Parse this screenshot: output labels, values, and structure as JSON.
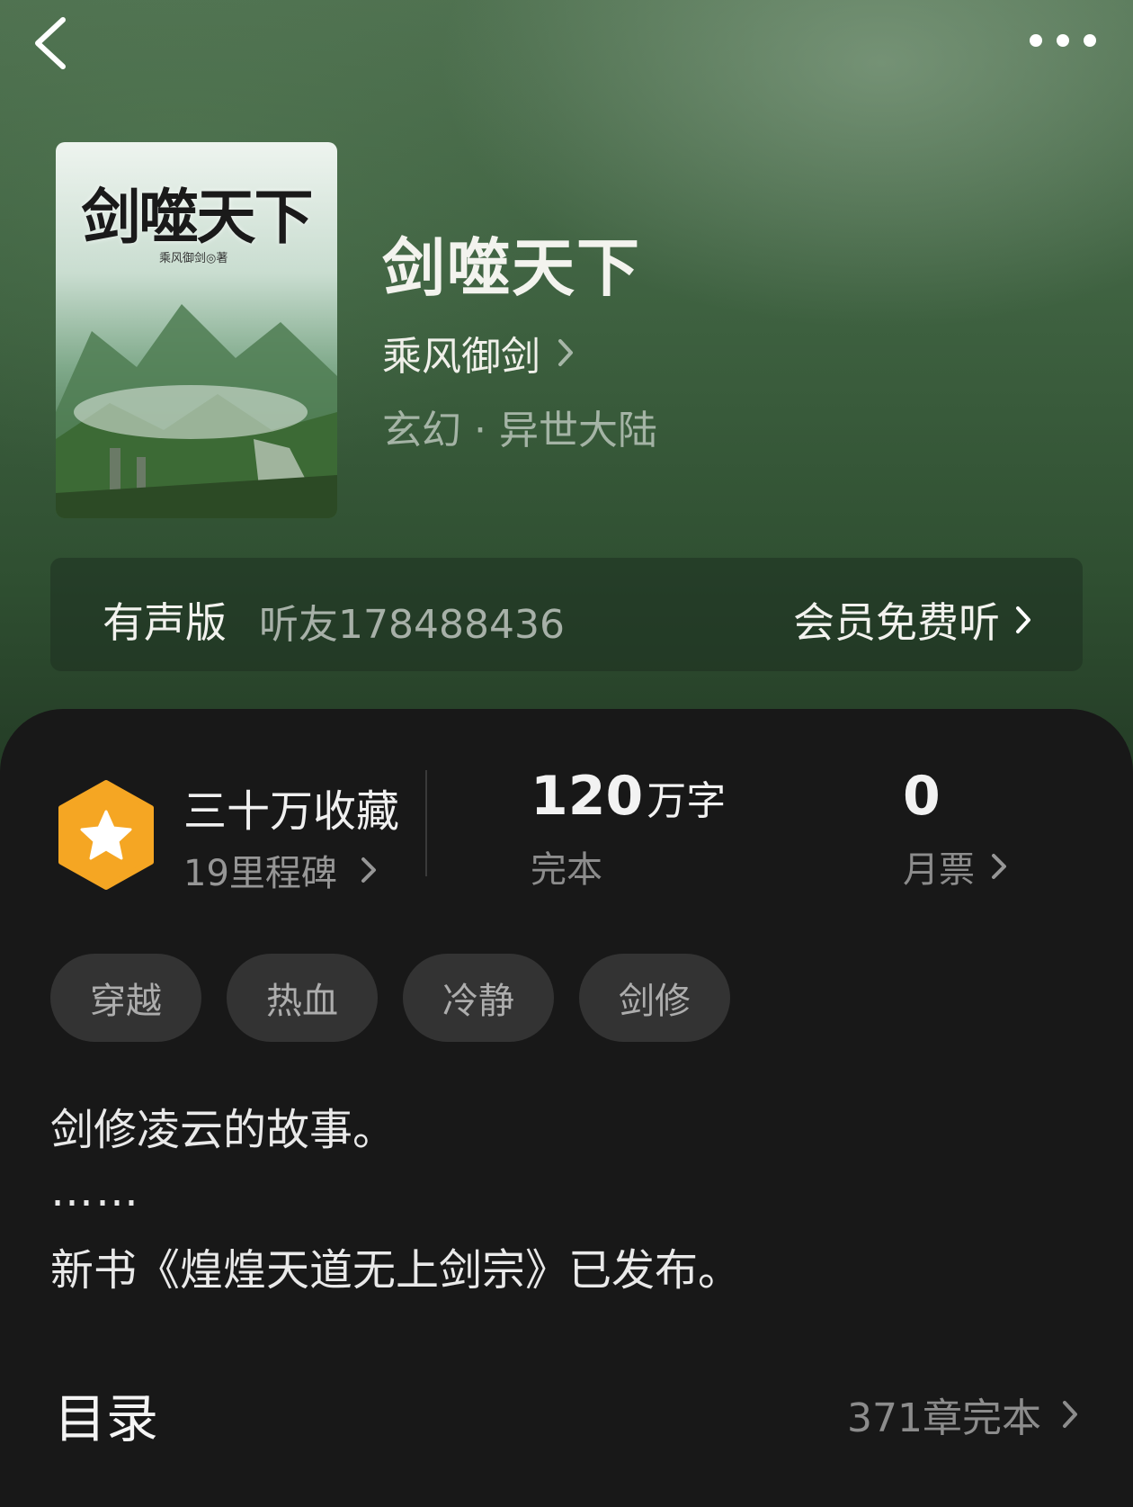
{
  "book": {
    "title": "剑噬天下",
    "author": "乘风御剑",
    "genre": "玄幻 · 异世大陆",
    "cover": {
      "title": "剑噬天下",
      "author_line": "乘风御剑◎著"
    }
  },
  "audio": {
    "label": "有声版",
    "narrator": "听友178488436",
    "cta": "会员免费听"
  },
  "stats": {
    "favorites": {
      "title": "三十万收藏",
      "subtitle": "19里程碑"
    },
    "words": {
      "value": "120",
      "unit": "万字",
      "label": "完本"
    },
    "votes": {
      "value": "0",
      "label": "月票"
    }
  },
  "tags": [
    "穿越",
    "热血",
    "冷静",
    "剑修"
  ],
  "description": {
    "line1": "剑修凌云的故事。",
    "dots": "……",
    "line2": "新书《煌煌天道无上剑宗》已发布。"
  },
  "toc": {
    "title": "目录",
    "meta": "371章完本"
  },
  "colors": {
    "badge": "#f5a623",
    "background": "#181818",
    "hero": "#3e6140"
  }
}
